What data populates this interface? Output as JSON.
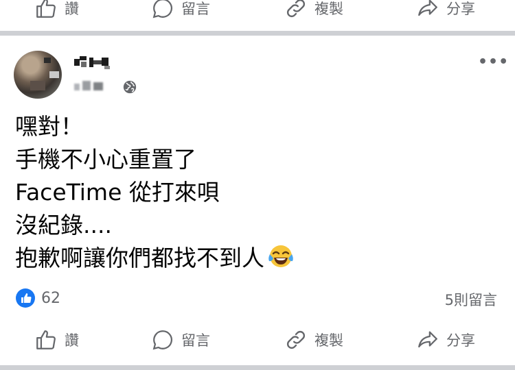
{
  "actions": {
    "like_label": "讚",
    "comment_label": "留言",
    "copy_label": "複製",
    "share_label": "分享"
  },
  "post": {
    "lines": [
      "嘿對！",
      "手機不小心重置了",
      "FaceTime 從打來唄",
      "沒紀錄....",
      "抱歉啊讓你們都找不到人"
    ],
    "emoji": "tears-of-joy-emoji",
    "more_menu": "•••"
  },
  "stats": {
    "like_count": "62",
    "comments": "5則留言"
  },
  "colors": {
    "like_blue": "#1877f2",
    "secondary_text": "#65676b",
    "divider": "#ced0d4"
  }
}
